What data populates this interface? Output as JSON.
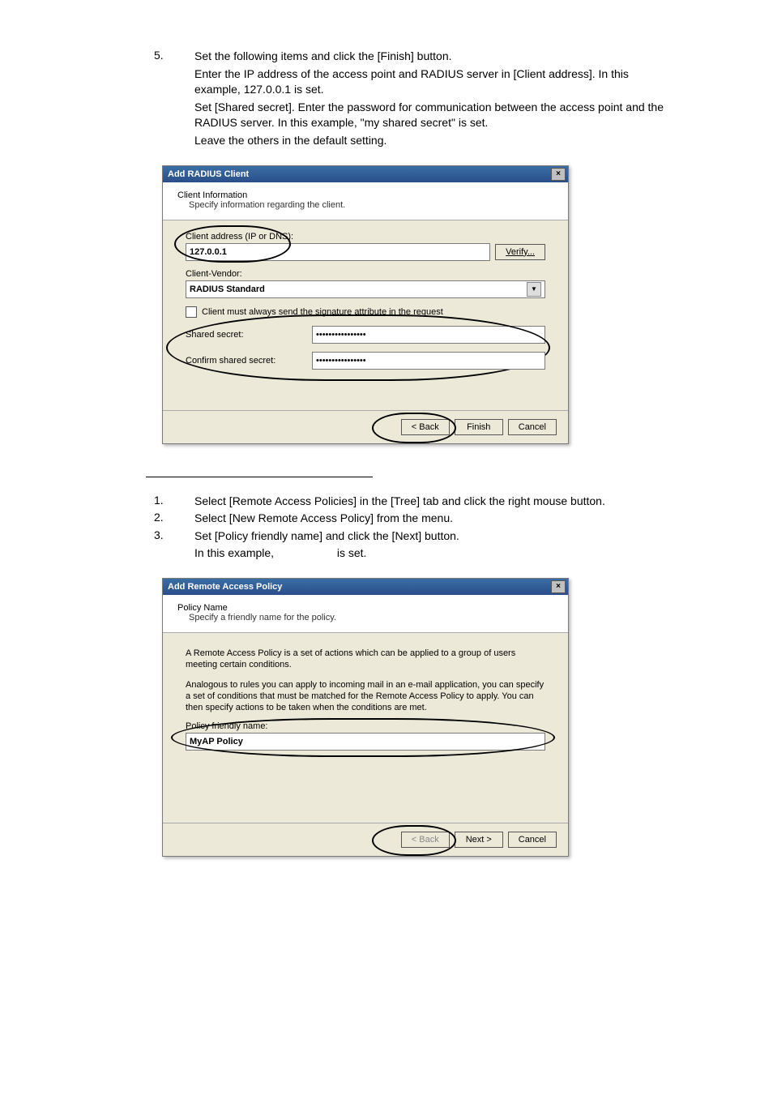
{
  "step5": {
    "num": "5.",
    "line1": "Set the following items and click the [Finish] button.",
    "line2": "Enter the IP address of the access point and RADIUS server in [Client address]. In this example, 127.0.0.1 is set.",
    "line3": "Set [Shared secret]. Enter the password for communication between the access point and the RADIUS server. In this example, \"my shared secret\" is set.",
    "line4": "Leave the others in the default setting."
  },
  "dlg1": {
    "title": "Add RADIUS Client",
    "close": "×",
    "hdr_title": "Client Information",
    "hdr_sub": "Specify information regarding the client.",
    "addr_label": "Client address (IP or DNS):",
    "addr_value": "127.0.0.1",
    "verify_btn": "Verify...",
    "vendor_label": "Client-Vendor:",
    "vendor_value": "RADIUS Standard",
    "checkbox_label": "Client must always send the signature attribute in the request",
    "shared_label": "Shared secret:",
    "confirm_label": "Confirm shared secret:",
    "back_btn": "< Back",
    "finish_btn": "Finish",
    "cancel_btn": "Cancel"
  },
  "steps_b": {
    "s1_num": "1.",
    "s1_txt": "Select [Remote Access Policies] in the [Tree] tab and click the right mouse button.",
    "s2_num": "2.",
    "s2_txt": "Select [New Remote Access Policy] from the menu.",
    "s3_num": "3.",
    "s3_line1": "Set [Policy friendly name] and click the [Next] button.",
    "s3_line2a": "In this example, ",
    "s3_line2b": " is set."
  },
  "dlg2": {
    "title": "Add Remote Access Policy",
    "close": "×",
    "hdr_title": "Policy Name",
    "hdr_sub": "Specify a friendly name for the policy.",
    "para1": "A Remote Access Policy is a set of actions which can be applied to a group of users meeting certain conditions.",
    "para2": "Analogous to rules you can apply to incoming mail in an e-mail application, you can specify a set of conditions that must be matched for the Remote Access Policy to apply. You can then specify actions to be taken when the conditions are met.",
    "name_label": "Policy friendly name:",
    "name_value": "MyAP Policy",
    "back_btn": "< Back",
    "next_btn": "Next >",
    "cancel_btn": "Cancel"
  }
}
